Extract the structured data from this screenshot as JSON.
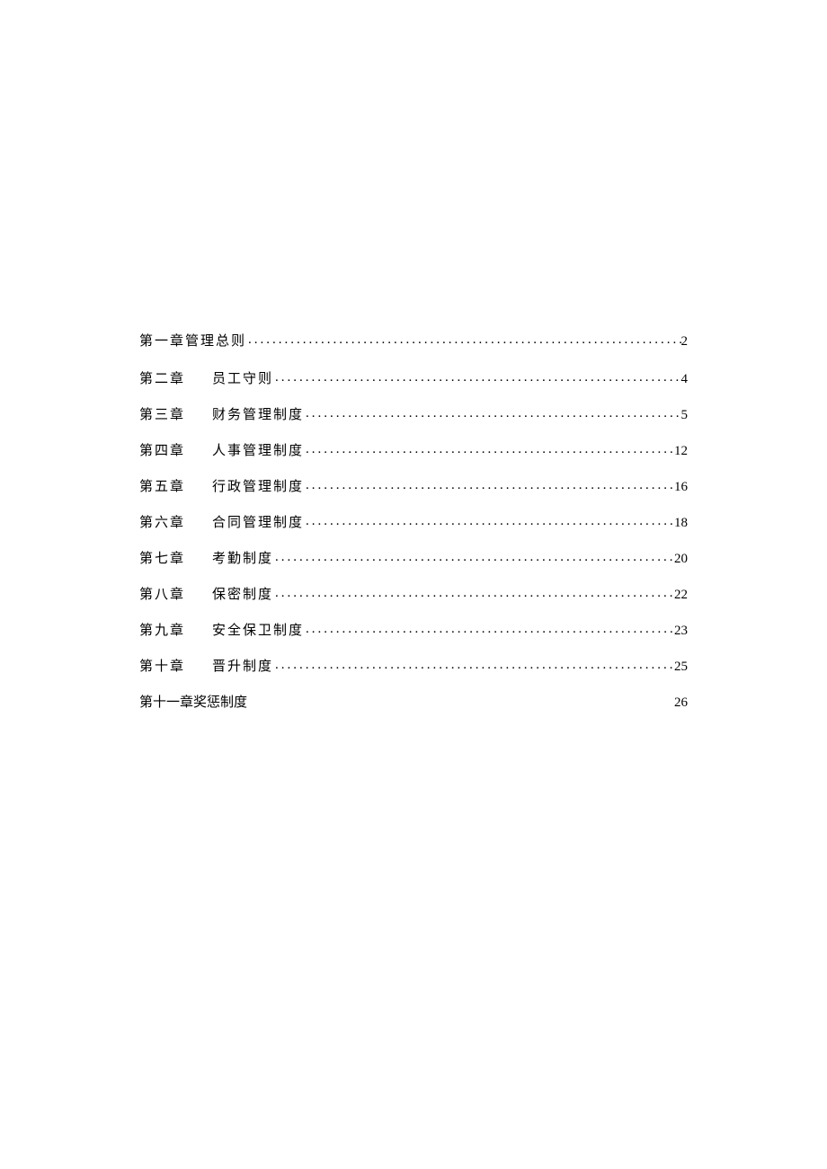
{
  "toc": {
    "entries": [
      {
        "chapter": "第一章",
        "title": "管理总则",
        "page": "2",
        "merged": true,
        "has_dots": true
      },
      {
        "chapter": "第二章",
        "title": "员工守则",
        "page": "4",
        "merged": false,
        "has_dots": true
      },
      {
        "chapter": "第三章",
        "title": "财务管理制度",
        "page": "5",
        "merged": false,
        "has_dots": true
      },
      {
        "chapter": "第四章",
        "title": "人事管理制度",
        "page": "12",
        "merged": false,
        "has_dots": true
      },
      {
        "chapter": "第五章",
        "title": "行政管理制度",
        "page": "16",
        "merged": false,
        "has_dots": true
      },
      {
        "chapter": "第六章",
        "title": "合同管理制度",
        "page": "18",
        "merged": false,
        "has_dots": true
      },
      {
        "chapter": "第七章",
        "title": "考勤制度",
        "page": "20",
        "merged": false,
        "has_dots": true
      },
      {
        "chapter": "第八章",
        "title": "保密制度",
        "page": "22",
        "merged": false,
        "has_dots": true
      },
      {
        "chapter": "第九章",
        "title": "安全保卫制度",
        "page": "23",
        "merged": false,
        "has_dots": true
      },
      {
        "chapter": "第十章",
        "title": "晋升制度",
        "page": "25",
        "merged": false,
        "has_dots": true
      },
      {
        "chapter": "第十一章",
        "title": "奖惩制度",
        "page": "26",
        "merged": true,
        "has_dots": false
      }
    ],
    "gap_spaces": "　　"
  }
}
